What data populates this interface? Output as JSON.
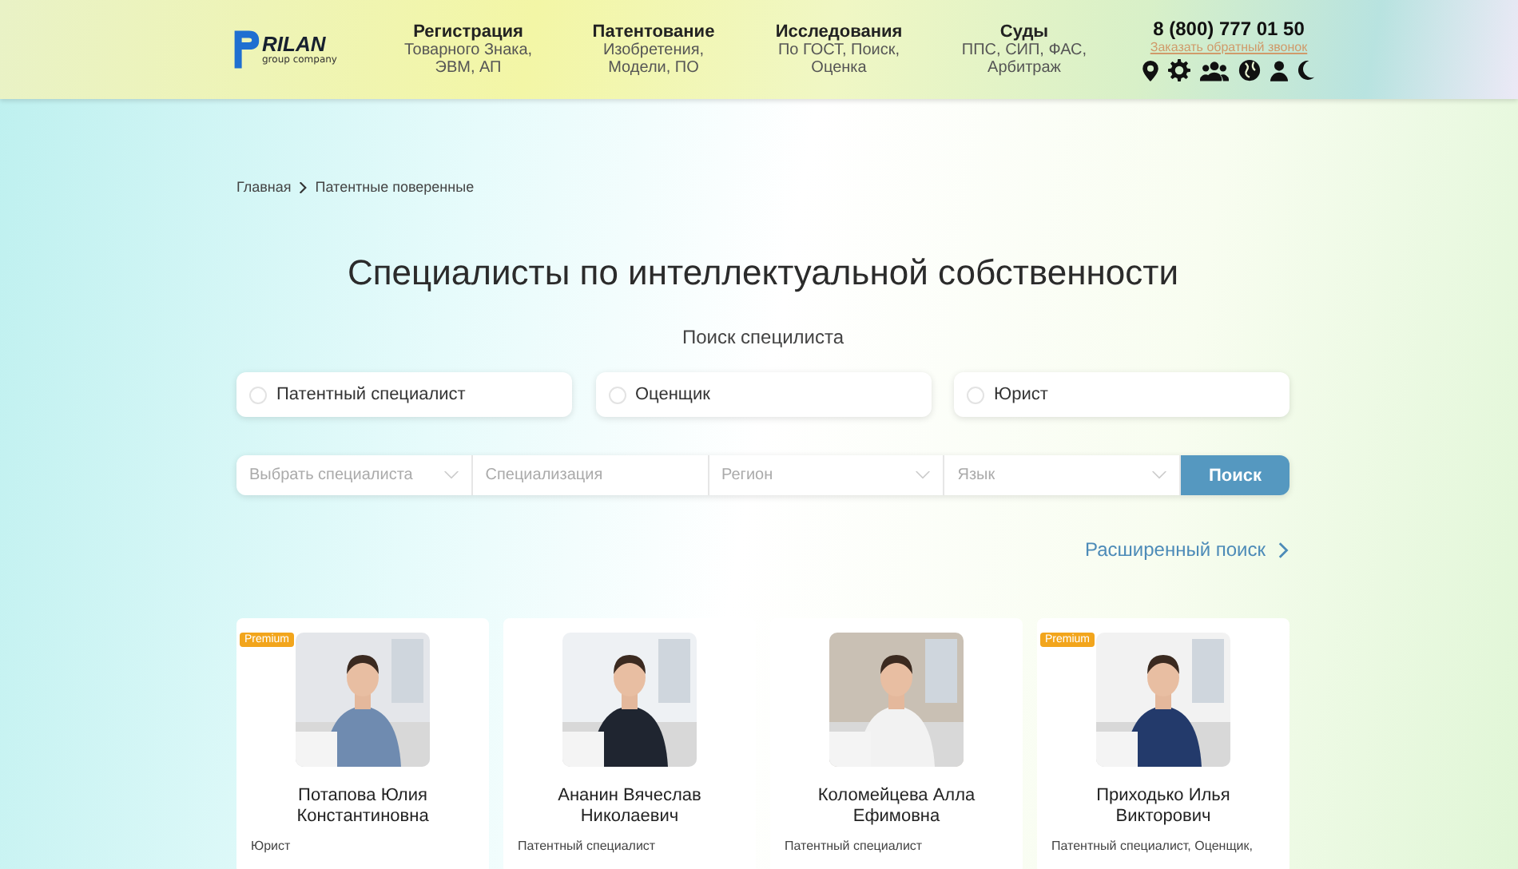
{
  "logo": {
    "name": "RILAN",
    "tagline": "group company"
  },
  "nav": [
    {
      "title": "Регистрация",
      "subtitle": "Товарного Знака, ЭВМ, АП"
    },
    {
      "title": "Патентование",
      "subtitle": "Изобретения, Модели, ПО"
    },
    {
      "title": "Исследования",
      "subtitle": "По ГОСТ, Поиск, Оценка"
    },
    {
      "title": "Суды",
      "subtitle": "ППС, СИП, ФАС, Арбитраж"
    }
  ],
  "contact": {
    "phone": "8 (800) 777 01 50",
    "callback": "Заказать обратный звонок"
  },
  "header_icons": [
    {
      "kind": "pin"
    },
    {
      "kind": "gear"
    },
    {
      "kind": "group"
    },
    {
      "kind": "globe"
    },
    {
      "kind": "person"
    },
    {
      "kind": "moon"
    }
  ],
  "breadcrumbs": [
    "Главная",
    "Патентные поверенные"
  ],
  "title": "Специалисты по интеллектуальной собственности",
  "search_label": "Поиск специлиста",
  "types": [
    {
      "label": "Патентный специалист",
      "selected": false
    },
    {
      "label": "Оценщик",
      "selected": false
    },
    {
      "label": "Юрист",
      "selected": false
    }
  ],
  "filters": [
    {
      "placeholder": "Выбрать специалиста",
      "kind": "select"
    },
    {
      "placeholder": "Специализация",
      "kind": "text"
    },
    {
      "placeholder": "Регион",
      "kind": "select"
    },
    {
      "placeholder": "Язык",
      "kind": "select"
    }
  ],
  "search_button": "Поиск",
  "advanced_search": "Расширенный поиск",
  "cards": [
    {
      "premium": true,
      "badge": "Premium",
      "name": "Потапова Юлия Константиновна",
      "role": "Юрист"
    },
    {
      "premium": false,
      "name": "Ананин Вячеслав Николаевич",
      "role": "Патентный специалист"
    },
    {
      "premium": false,
      "name": "Коломейцева Алла Ефимовна",
      "role": "Патентный специалист"
    },
    {
      "premium": true,
      "badge": "Premium",
      "name": "Приходько Илья Викторович",
      "role": "Патентный специалист, Оценщик,"
    }
  ]
}
